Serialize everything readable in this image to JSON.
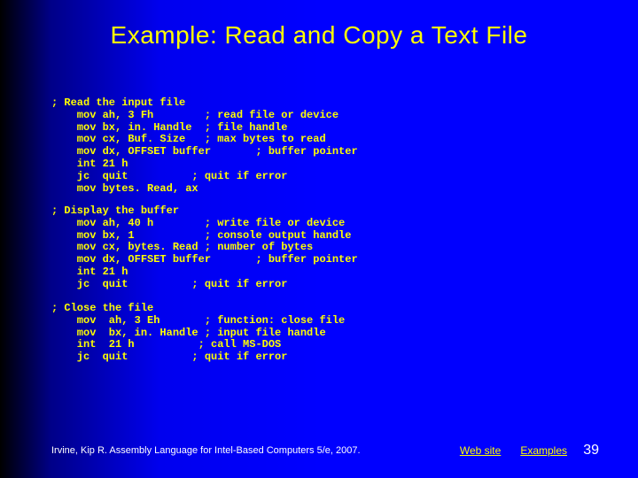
{
  "title": "Example: Read and Copy a Text File",
  "code": {
    "block1": "; Read the input file\n    mov ah, 3 Fh        ; read file or device\n    mov bx, in. Handle  ; file handle\n    mov cx, Buf. Size   ; max bytes to read\n    mov dx, OFFSET buffer       ; buffer pointer\n    int 21 h\n    jc  quit          ; quit if error\n    mov bytes. Read, ax",
    "block2": "; Display the buffer\n    mov ah, 40 h        ; write file or device\n    mov bx, 1           ; console output handle\n    mov cx, bytes. Read ; number of bytes\n    mov dx, OFFSET buffer       ; buffer pointer\n    int 21 h\n    jc  quit          ; quit if error",
    "block3": "; Close the file\n    mov  ah, 3 Eh       ; function: close file\n    mov  bx, in. Handle ; input file handle\n    int  21 h          ; call MS-DOS\n    jc  quit          ; quit if error"
  },
  "footer": {
    "credit": "Irvine, Kip R. Assembly Language for Intel-Based Computers 5/e, 2007.",
    "link_web": "Web site",
    "link_examples": "Examples",
    "page": "39"
  }
}
